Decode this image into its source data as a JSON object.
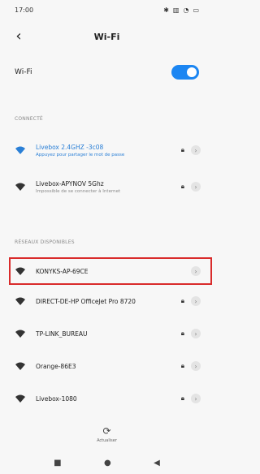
{
  "status": {
    "time": "17:00",
    "icons": [
      "bluetooth-icon",
      "signal-icon",
      "wifi-icon",
      "battery-icon"
    ]
  },
  "header": {
    "title": "Wi-Fi"
  },
  "wifi": {
    "label": "Wi-Fi",
    "enabled": true
  },
  "connected_section": {
    "label": "CONNECTÉ"
  },
  "connected_networks": [
    {
      "name": "Livebox 2.4GHZ -3c08",
      "sub": "Appuyez pour partager le mot de passe",
      "connected": true
    },
    {
      "name": "Livebox-APYNOV 5Ghz",
      "sub": "Impossible de se connecter à Internet",
      "connected": false
    }
  ],
  "available_section": {
    "label": "RÉSEAUX DISPONIBLES"
  },
  "available_networks": [
    {
      "name": "KONYKS-AP-69CE",
      "locked": false
    },
    {
      "name": "DIRECT-DE-HP OfficeJet Pro 8720",
      "locked": true
    },
    {
      "name": "TP-LINK_BUREAU",
      "locked": true
    },
    {
      "name": "Orange-86E3",
      "locked": true
    },
    {
      "name": "Livebox-1080",
      "locked": true
    }
  ],
  "refresh": {
    "label": "Actualiser"
  }
}
